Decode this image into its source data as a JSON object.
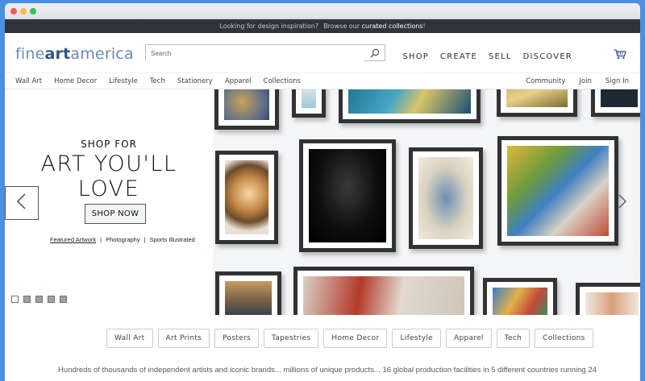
{
  "promo_bar": {
    "text": "Looking for design inspiration?",
    "prefix": "Browse our",
    "link": "curated collections",
    "suffix": "!"
  },
  "header": {
    "logo_parts": [
      "fine",
      "art",
      "america"
    ],
    "search_placeholder": "Search",
    "main_nav": [
      "SHOP",
      "CREATE",
      "SELL",
      "DISCOVER"
    ]
  },
  "subnav": {
    "left": [
      "Wall Art",
      "Home Decor",
      "Lifestyle",
      "Tech",
      "Stationery",
      "Apparel",
      "Collections"
    ],
    "right": [
      "Community",
      "Join",
      "Sign In"
    ]
  },
  "hero": {
    "eyebrow": "SHOP FOR",
    "headline_line1": "ART YOU'LL",
    "headline_line2": "LOVE",
    "cta": "SHOP NOW",
    "links": [
      "Featured Artwork",
      "Photography",
      "Sports Illustrated"
    ],
    "separator": "|",
    "slide_count": 5,
    "active_slide": 1
  },
  "tags": [
    "Wall Art",
    "Art Prints",
    "Posters",
    "Tapestries",
    "Home Decor",
    "Lifestyle",
    "Apparel",
    "Tech",
    "Collections"
  ],
  "description": "Hundreds of thousands of independent artists and iconic brands... millions of unique products... 16 global production facilities in 5 different countries running 24",
  "colors": {
    "accent": "#2f5485",
    "promo_bg": "#2f3439",
    "frame": "#303234",
    "page_bg": "#4a8fe0"
  }
}
